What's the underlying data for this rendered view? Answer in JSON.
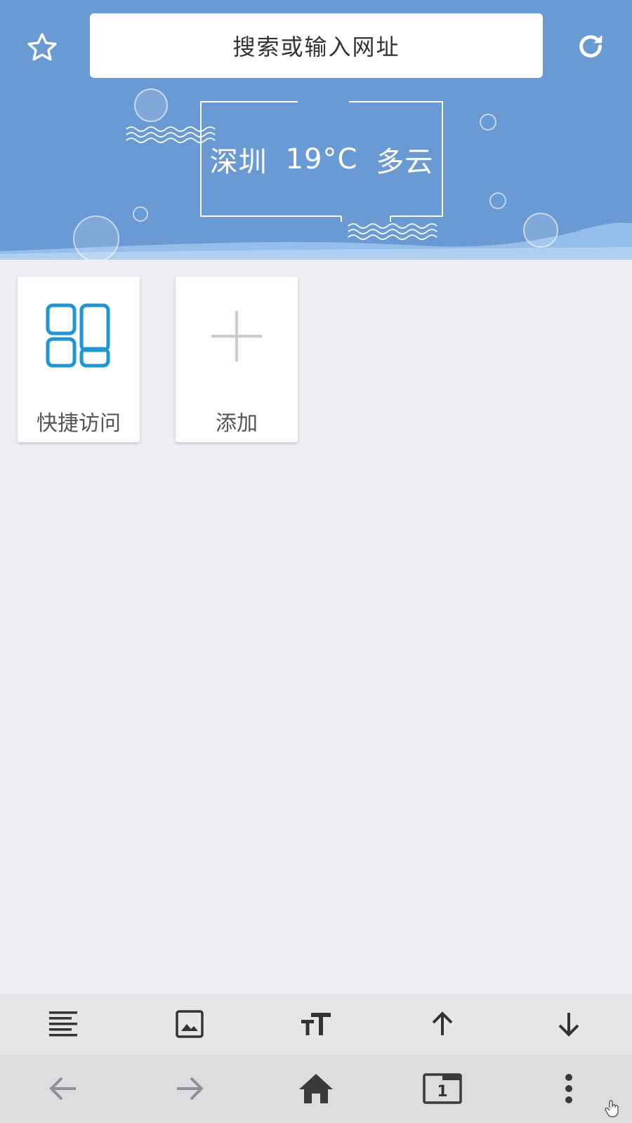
{
  "header": {
    "search_placeholder": "搜索或输入网址",
    "weather": {
      "city": "深圳",
      "temperature": "19°C",
      "condition": "多云"
    },
    "background_color": "#6a9ad4"
  },
  "tiles": [
    {
      "label": "快捷访问",
      "icon": "quick-access-grid-icon",
      "icon_color": "#1e96d2"
    },
    {
      "label": "添加",
      "icon": "plus-icon",
      "icon_color": "#c8cad8"
    }
  ],
  "toolbar": {
    "items": [
      "text-align-icon",
      "image-icon",
      "font-size-icon",
      "arrow-up-icon",
      "arrow-down-icon"
    ]
  },
  "navbar": {
    "items": [
      "back-icon",
      "forward-icon",
      "home-icon",
      "tabs-icon",
      "more-menu-icon"
    ],
    "tabs_count": "1"
  }
}
